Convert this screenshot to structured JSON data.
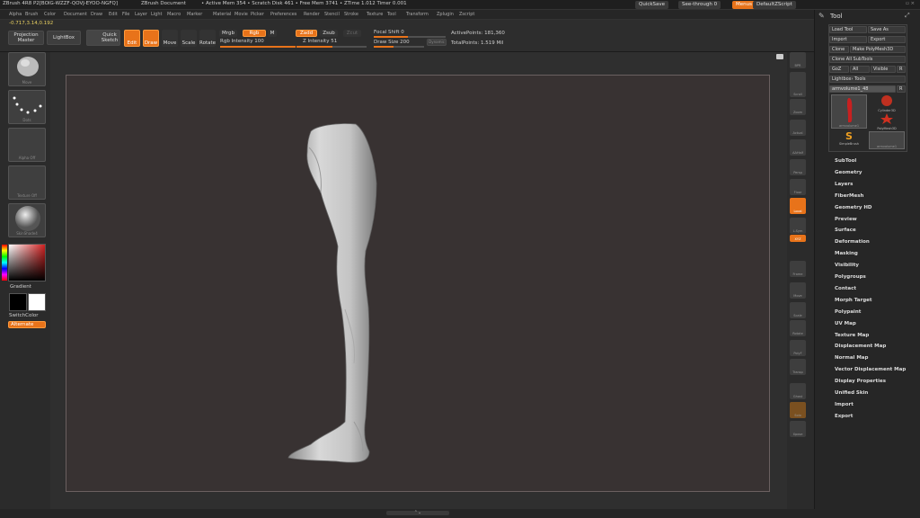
{
  "titlebar": {
    "app": "ZBrush 4R8 P2[BOIG-WZZF-QOVJ-EYOO-NGFQ]",
    "document": "ZBrush Document",
    "mem": "• Active Mem 354 • Scratch Disk 461 • Free Mem 3741 • ZTime 1.012 Timer 0.001",
    "quicksave": "QuickSave",
    "seethrough": "See-through  0",
    "menus": "Menus",
    "script": "DefaultZScript"
  },
  "menubar": [
    "Alpha",
    "Brush",
    "Color",
    "Document",
    "Draw",
    "Edit",
    "File",
    "Layer",
    "Light",
    "Macro",
    "Marker",
    "Material",
    "Movie",
    "Picker",
    "Preferences",
    "Render",
    "Stencil",
    "Stroke",
    "Texture",
    "Tool",
    "Transform",
    "Zplugin",
    "Zscript"
  ],
  "toolbar": {
    "coords": "-0.717,3.14,0.192",
    "projection_master": "Projection Master",
    "lightbox": "LightBox",
    "quick_sketch": "Quick Sketch",
    "edit": "Edit",
    "draw": "Draw",
    "move": "Move",
    "scale": "Scale",
    "rotate": "Rotate",
    "mrgb": "Mrgb",
    "rgb": "Rgb",
    "m": "M",
    "zadd": "Zadd",
    "zsub": "Zsub",
    "zcut": "Zcut",
    "rgb_intensity": "Rgb Intensity 100",
    "z_intensity": "Z Intensity 51",
    "focal_shift": "Focal Shift 0",
    "draw_size": "Draw Size 200",
    "dynamic": "Dynamic",
    "active_points": "ActivePoints: 181,360",
    "total_points": "TotalPoints: 1.519 Mil"
  },
  "leftshelf": {
    "brush_cap": "Move",
    "stroke_cap": "Dots",
    "alpha_cap": "Alpha Off",
    "texture_cap": "Texture Off",
    "material_cap": "SkinShade4",
    "gradient": "Gradient",
    "switchcolor": "SwitchColor",
    "alternate": "Alternate"
  },
  "rightshelf": [
    "BPR",
    "SPix",
    "Scroll",
    "Zoom",
    "Actual",
    "AAHalf",
    "Persp",
    "Floor",
    "Local",
    "L.Sym",
    "XYZ",
    "Frame",
    "Move",
    "Scale",
    "Rotate",
    "PolyF",
    "Transp",
    "Ghost",
    "Solo",
    "Xpose"
  ],
  "toolpanel": {
    "title": "Tool",
    "load_tool": "Load Tool",
    "save_as": "Save As",
    "import": "Import",
    "export": "Export",
    "clone": "Clone",
    "make_polymesh": "Make PolyMesh3D",
    "clone_all": "Clone All SubTools",
    "goz": "GoZ",
    "all": "All",
    "visible": "Visible",
    "r": "R",
    "lightbox_tools": "Lightbox› Tools",
    "current_tool": "armvolume1_48",
    "tool_thumbs": [
      "armvolume1",
      "Cylinder3D",
      "PolyMesh3D",
      "SimpleBrush",
      "armvolume1"
    ],
    "sections": [
      "SubTool",
      "Geometry",
      "Layers",
      "FiberMesh",
      "Geometry HD",
      "Preview",
      "Surface",
      "Deformation",
      "Masking",
      "Visibility",
      "Polygroups",
      "Contact",
      "Morph Target",
      "Polypaint",
      "UV Map",
      "Texture Map",
      "Displacement Map",
      "Normal Map",
      "Vector Displacement Map",
      "Display Properties",
      "Unified Skin",
      "Import",
      "Export"
    ]
  },
  "colors": {
    "accent": "#e8731a",
    "canvas": "#383232",
    "model": "#d2d2d2"
  }
}
